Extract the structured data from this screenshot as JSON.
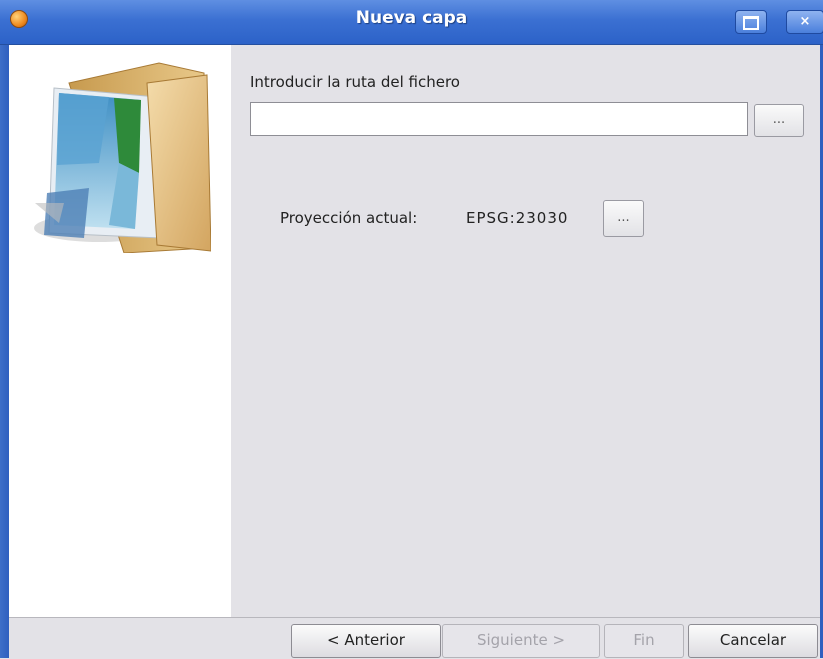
{
  "window": {
    "title": "Nueva capa",
    "close_glyph": "×"
  },
  "icons": {
    "app": "gvsig-app-icon",
    "side_image": "folder-with-pictures-icon"
  },
  "file": {
    "label": "Introducir la ruta del fichero",
    "path_value": "",
    "browse_label": "..."
  },
  "projection": {
    "label": "Proyección actual:",
    "value": "EPSG:23030",
    "change_label": "..."
  },
  "buttons": {
    "previous": "< Anterior",
    "next": "Siguiente >",
    "finish": "Fin",
    "cancel": "Cancelar"
  },
  "colors": {
    "titlebar": "#3b70d2",
    "background": "#e3e2e7",
    "disabled_text": "#a4a3aa"
  }
}
